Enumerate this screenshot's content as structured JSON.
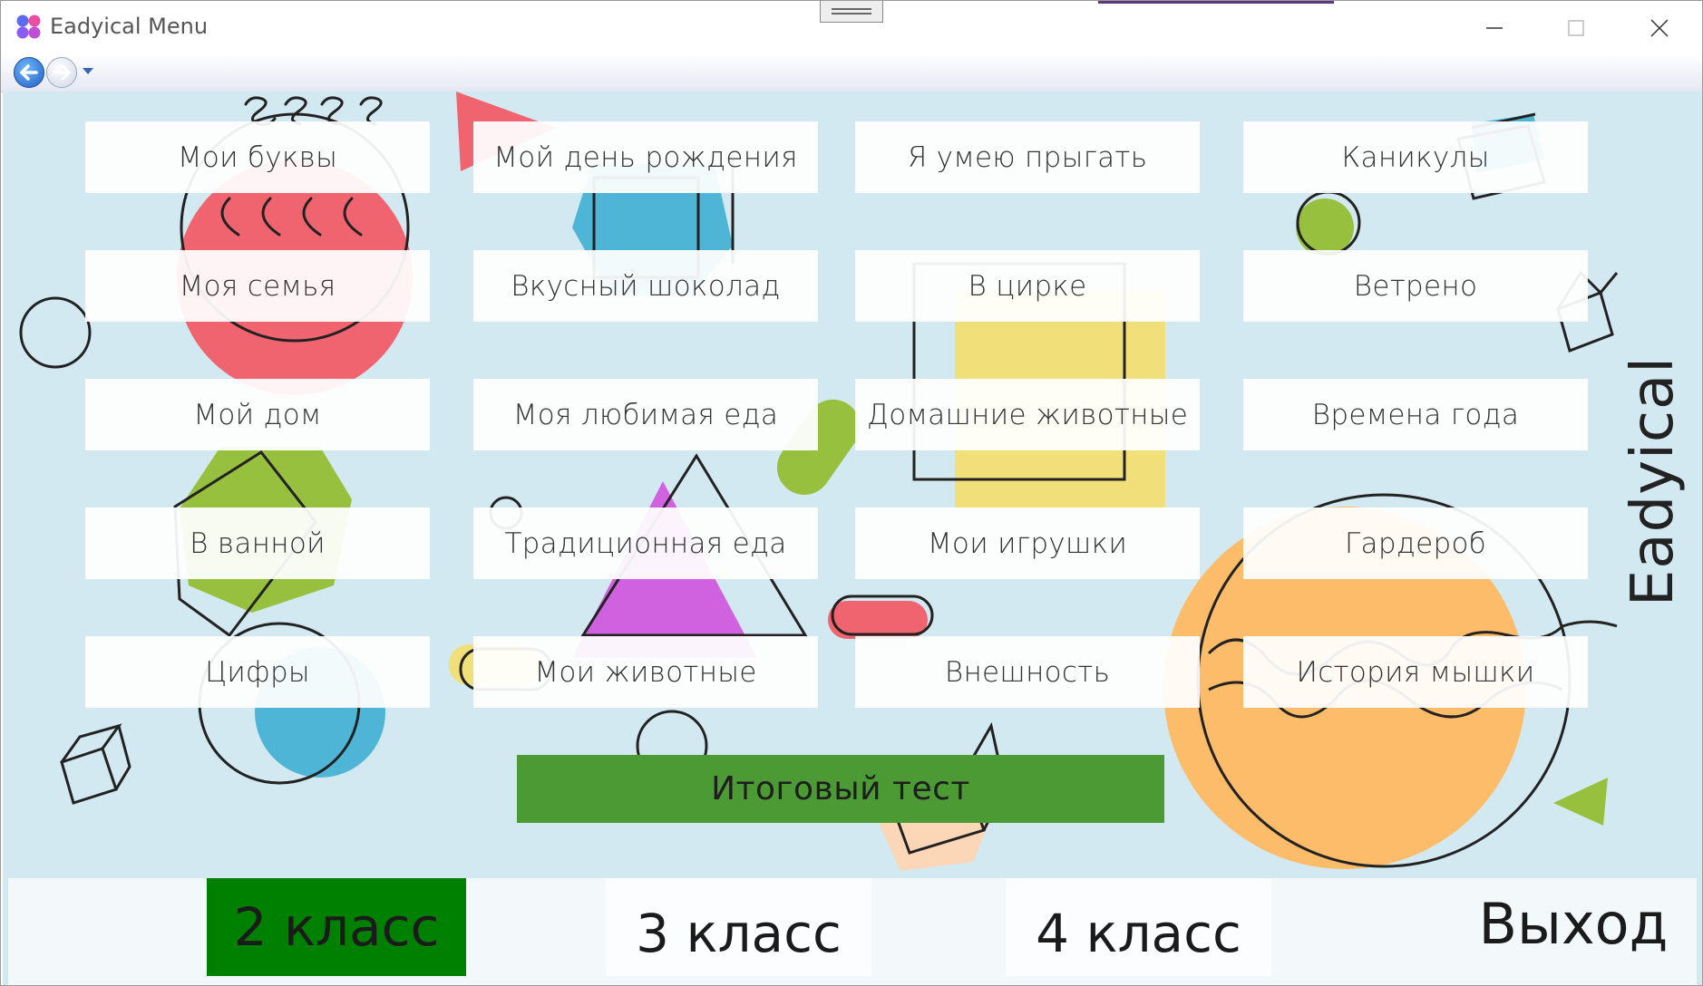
{
  "window": {
    "title": "Eadyical Menu"
  },
  "topics": [
    "Мои буквы",
    "Мой день рождения",
    "Я умею прыгать",
    "Каникулы",
    "Моя семья",
    "Вкусный шоколад",
    "В цирке",
    "Ветрено",
    "Мой дом",
    "Моя любимая еда",
    "Домашние животные",
    "Времена года",
    "В ванной",
    "Традиционная еда",
    "Мои игрушки",
    "Гардероб",
    "Цифры",
    "Мои животные",
    "Внешность",
    "История мышки"
  ],
  "final_test": {
    "label": "Итоговый тест",
    "color": "#4c9a34"
  },
  "brand": "Eadyical",
  "grades": {
    "grade2": "2 класс",
    "grade3": "3 класс",
    "grade4": "4 класс",
    "active": "2 класс",
    "active_color": "#008000"
  },
  "exit_label": "Выход",
  "colors": {
    "background": "#d3e9f1",
    "accent_red": "#f06470",
    "accent_blue": "#4fb5d6",
    "accent_green": "#97c03e",
    "accent_yellow": "#f1e07a",
    "accent_purple": "#d062e0",
    "accent_orange": "#fcbc6a"
  },
  "icons": [
    "app-icon",
    "back-arrow-icon",
    "forward-arrow-icon",
    "nav-dropdown-icon",
    "minimize-icon",
    "maximize-icon",
    "close-icon"
  ]
}
